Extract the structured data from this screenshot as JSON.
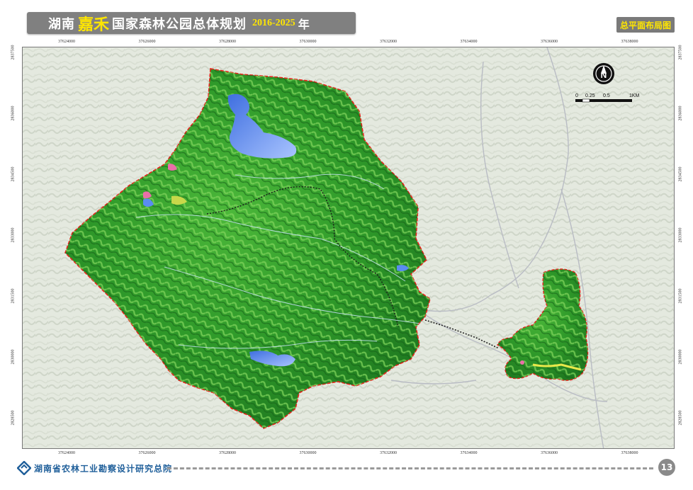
{
  "title": {
    "part1": "湖南",
    "part2": "嘉禾",
    "part3": "国家森林公园总体规划",
    "years": "2016-2025",
    "year_char": "年"
  },
  "map_label": "总平面布局图",
  "scale_bar": {
    "labels": [
      "0",
      "0.25",
      "0.5",
      "1KM"
    ]
  },
  "north_arrow": {
    "icon": "north-arrow-icon",
    "letter": "N"
  },
  "x_ticks": [
    "37624000",
    "37626000",
    "37628000",
    "37630000",
    "37632000",
    "37634000",
    "37636000",
    "37638000"
  ],
  "y_ticks": [
    "2837500",
    "2836000",
    "2834500",
    "2833000",
    "2831500",
    "2830000",
    "2828500"
  ],
  "footer": {
    "org": "湖南省农林工业勘察设计研究总院",
    "page": "13"
  },
  "colors": {
    "forest": "#2f9a2a",
    "forest_light": "#7fd35a",
    "water": "#5a8cf0",
    "boundary": "#e8241c",
    "title_bg": "#808080",
    "accent_yellow": "#ffe600"
  }
}
